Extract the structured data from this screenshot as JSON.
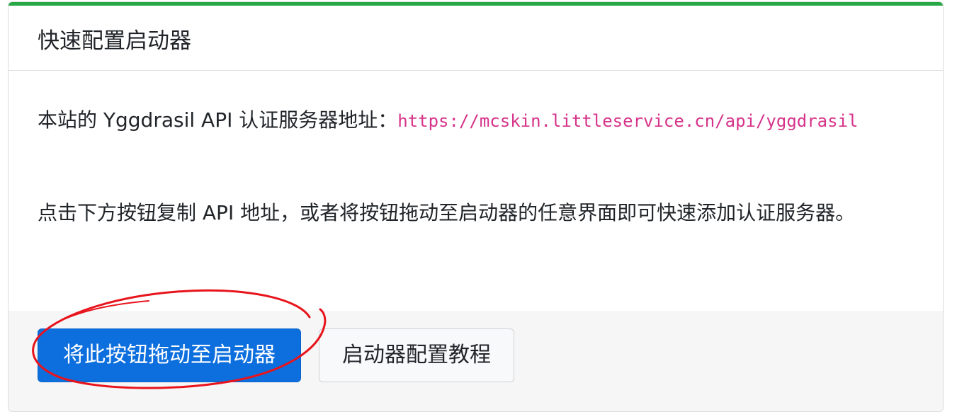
{
  "card": {
    "title": "快速配置启动器",
    "accent_color": "#28a745"
  },
  "body": {
    "server_label": "本站的 Yggdrasil API 认证服务器地址：",
    "server_url": "https://mcskin.littleservice.cn/api/yggdrasil",
    "instructions": "点击下方按钮复制 API 地址，或者将按钮拖动至启动器的任意界面即可快速添加认证服务器。",
    "url_color": "#d6338a"
  },
  "footer": {
    "drag_button_label": "将此按钮拖动至启动器",
    "tutorial_button_label": "启动器配置教程",
    "primary_color": "#0d6fde"
  },
  "annotation": {
    "type": "red hand-drawn circle around drag button",
    "color": "#e8141c"
  }
}
